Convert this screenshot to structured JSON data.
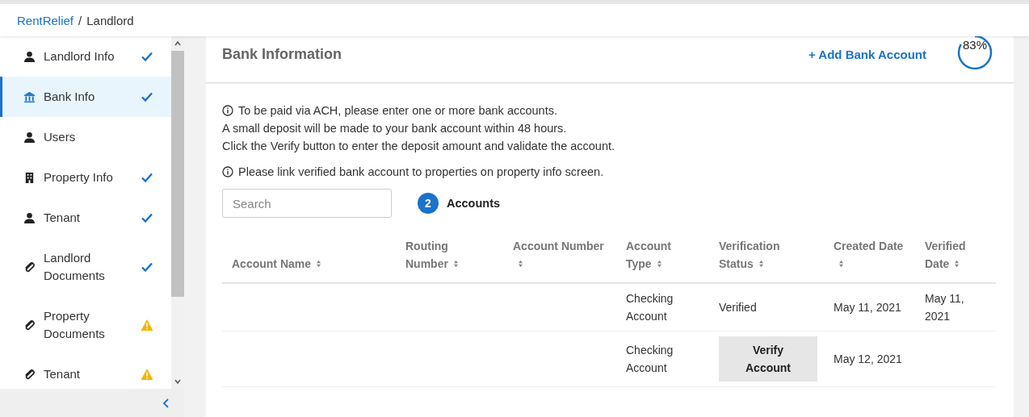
{
  "breadcrumb": {
    "root": "RentRelief",
    "separator": "/",
    "current": "Landlord"
  },
  "sidebar": {
    "items": [
      {
        "label": "Landlord Info",
        "kind": "person",
        "checked": true,
        "warning": false,
        "selected": false
      },
      {
        "label": "Bank Info",
        "kind": "bank",
        "checked": true,
        "warning": false,
        "selected": true
      },
      {
        "label": "Users",
        "kind": "person",
        "checked": false,
        "warning": false,
        "selected": false
      },
      {
        "label": "Property Info",
        "kind": "building",
        "checked": true,
        "warning": false,
        "selected": false
      },
      {
        "label": "Tenant",
        "kind": "person",
        "checked": true,
        "warning": false,
        "selected": false
      },
      {
        "label": "Landlord Documents",
        "kind": "paperclip",
        "checked": true,
        "warning": false,
        "selected": false
      },
      {
        "label": "Property Documents",
        "kind": "paperclip",
        "checked": false,
        "warning": true,
        "selected": false
      },
      {
        "label": "Tenant",
        "kind": "paperclip",
        "checked": false,
        "warning": true,
        "selected": false
      }
    ]
  },
  "header": {
    "title": "Bank Information",
    "add_button": "+ Add Bank Account",
    "progress": {
      "reading": "83%"
    }
  },
  "notes": [
    {
      "lines": [
        "To be paid via ACH, please enter one or more bank accounts.",
        "A small deposit will be made to your bank account within 48 hours.",
        "Click the Verify button to enter the deposit amount and validate the account."
      ]
    },
    {
      "lines": [
        "Please link verified bank account to properties on property info screen."
      ]
    }
  ],
  "search": {
    "placeholder": "Search"
  },
  "accounts": {
    "count": "2",
    "label": "Accounts"
  },
  "table": {
    "columns": [
      "Account Name",
      "Routing Number",
      "Account Number",
      "Account Type",
      "Verification Status",
      "Created Date",
      "Verified Date"
    ],
    "rows": [
      {
        "account_type": "Checking Account",
        "verification_status": {
          "kind": "text",
          "label": "Verified"
        },
        "created_date": "May 11, 2021",
        "verified_date": "May 11, 2021"
      },
      {
        "account_type": "Checking Account",
        "verification_status": {
          "kind": "button",
          "label": "Verify Account"
        },
        "created_date": "May 12, 2021"
      }
    ]
  }
}
